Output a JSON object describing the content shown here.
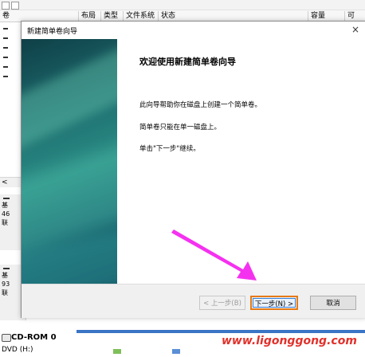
{
  "disk_mgmt": {
    "columns": [
      "卷",
      "布局",
      "类型",
      "文件系统",
      "状态",
      "容量",
      "可"
    ],
    "scroll_left": "<",
    "disk_labels": [
      {
        "type": "基",
        "size": "46",
        "status": "联"
      },
      {
        "type": "基",
        "size": "93",
        "status": "联"
      }
    ],
    "cdrom": {
      "title": "CD-ROM 0",
      "sub": "DVD (H:)"
    }
  },
  "wizard": {
    "title": "新建简单卷向导",
    "close_glyph": "×",
    "heading": "欢迎使用新建简单卷向导",
    "paragraphs": [
      "此向导帮助你在磁盘上创建一个简单卷。",
      "简单卷只能在单一磁盘上。",
      "单击\"下一步\"继续。"
    ],
    "buttons": {
      "back": "< 上一步(B)",
      "next": "下一步(N) >",
      "cancel": "取消"
    }
  },
  "watermark": "www.ligonggong.com",
  "colors": {
    "annotation_arrow": "#f531f0",
    "next_focus": "#e67a12",
    "watermark": "#e0312b",
    "cdrom_bar": "#3a74c4"
  }
}
